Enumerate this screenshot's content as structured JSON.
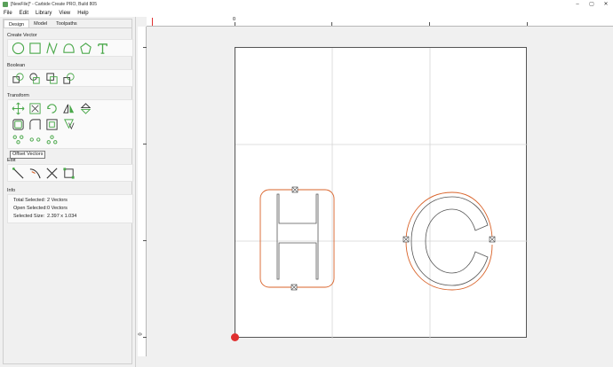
{
  "window": {
    "title": "[NewFile]* - Carbide Create PRO, Build 805",
    "controls": [
      "–",
      "▢",
      "✕"
    ]
  },
  "menu": [
    "File",
    "Edit",
    "Library",
    "View",
    "Help"
  ],
  "tabs": [
    "Design",
    "Model",
    "Toolpaths"
  ],
  "sections": {
    "create_vector": "Create Vector",
    "boolean": "Boolean",
    "transform": "Transform",
    "edit": "Edit",
    "info": "Info"
  },
  "tooltip": "Offset Vectors",
  "info": {
    "total_selected_label": "Total Selected:",
    "total_selected_value": "2 Vectors",
    "open_selected_label": "Open Selected:",
    "open_selected_value": "0 Vectors",
    "selected_size_label": "Selected Size:",
    "selected_size_value": "2.397 x 1.034"
  },
  "ruler": {
    "h_zero": "0",
    "v_zero": "0"
  },
  "colors": {
    "icon_green": "#4aa84a",
    "vector_orange": "#d9632a",
    "grid": "#d4d4d4",
    "ruler_mark": "#e03030"
  }
}
